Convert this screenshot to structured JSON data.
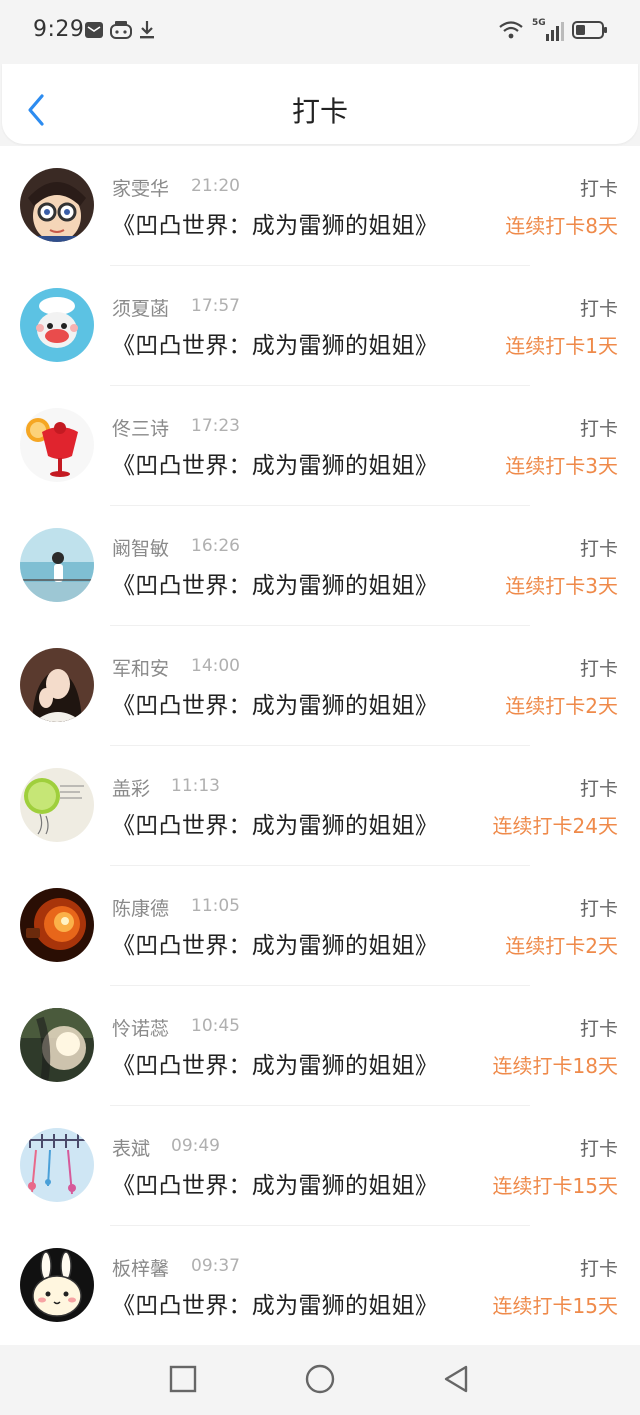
{
  "status_bar": {
    "time": "9:29",
    "network": "5G"
  },
  "header": {
    "title": "打卡"
  },
  "icons": {
    "back": "back-chevron-icon",
    "mail": "mail-icon",
    "game": "gamepad-icon",
    "download": "download-icon",
    "wifi": "wifi-icon",
    "signal": "signal-icon",
    "battery": "battery-icon",
    "nav_recent": "square-icon",
    "nav_home": "circle-icon",
    "nav_back": "triangle-back-icon"
  },
  "colors": {
    "accent": "#ef8a4a",
    "back_arrow": "#2d8cf0"
  },
  "entries": [
    {
      "name": "家雯华",
      "time": "21:20",
      "book": "《凹凸世界：成为雷狮的姐姐》",
      "action": "打卡",
      "streak": "连续打卡8天"
    },
    {
      "name": "须夏菡",
      "time": "17:57",
      "book": "《凹凸世界：成为雷狮的姐姐》",
      "action": "打卡",
      "streak": "连续打卡1天"
    },
    {
      "name": "佟三诗",
      "time": "17:23",
      "book": "《凹凸世界：成为雷狮的姐姐》",
      "action": "打卡",
      "streak": "连续打卡3天"
    },
    {
      "name": "阚智敏",
      "time": "16:26",
      "book": "《凹凸世界：成为雷狮的姐姐》",
      "action": "打卡",
      "streak": "连续打卡3天"
    },
    {
      "name": "军和安",
      "time": "14:00",
      "book": "《凹凸世界：成为雷狮的姐姐》",
      "action": "打卡",
      "streak": "连续打卡2天"
    },
    {
      "name": "盖彩",
      "time": "11:13",
      "book": "《凹凸世界：成为雷狮的姐姐》",
      "action": "打卡",
      "streak": "连续打卡24天"
    },
    {
      "name": "陈康德",
      "time": "11:05",
      "book": "《凹凸世界：成为雷狮的姐姐》",
      "action": "打卡",
      "streak": "连续打卡2天"
    },
    {
      "name": "怜诺蕊",
      "time": "10:45",
      "book": "《凹凸世界：成为雷狮的姐姐》",
      "action": "打卡",
      "streak": "连续打卡18天"
    },
    {
      "name": "表斌",
      "time": "09:49",
      "book": "《凹凸世界：成为雷狮的姐姐》",
      "action": "打卡",
      "streak": "连续打卡15天"
    },
    {
      "name": "板梓馨",
      "time": "09:37",
      "book": "《凹凸世界：成为雷狮的姐姐》",
      "action": "打卡",
      "streak": "连续打卡15天"
    }
  ]
}
